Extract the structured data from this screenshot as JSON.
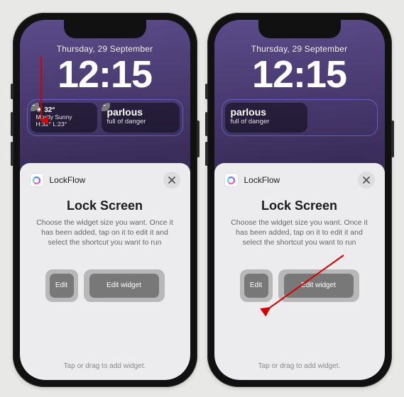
{
  "left": {
    "date": "Thursday, 29 September",
    "time": "12:15",
    "widgets": {
      "weather": {
        "temp": "32°",
        "condition": "Mostly Sunny",
        "hilo": "H:32° L:23°"
      },
      "word": {
        "title": "parlous",
        "subtitle": "full of danger"
      }
    },
    "sheet": {
      "appName": "LockFlow",
      "title": "Lock Screen",
      "desc": "Choose the widget size you want. Once it has been added, tap on it to edit it and select the shortcut you want to run",
      "preview_small": "Edit",
      "preview_large": "Edit widget",
      "hint": "Tap or drag to add widget."
    }
  },
  "right": {
    "date": "Thursday, 29 September",
    "time": "12:15",
    "widgets": {
      "word": {
        "title": "parlous",
        "subtitle": "full of danger"
      }
    },
    "sheet": {
      "appName": "LockFlow",
      "title": "Lock Screen",
      "desc": "Choose the widget size you want. Once it has been added, tap on it to edit it and select the shortcut you want to run",
      "preview_small": "Edit",
      "preview_large": "Edit widget",
      "hint": "Tap or drag to add widget."
    }
  }
}
